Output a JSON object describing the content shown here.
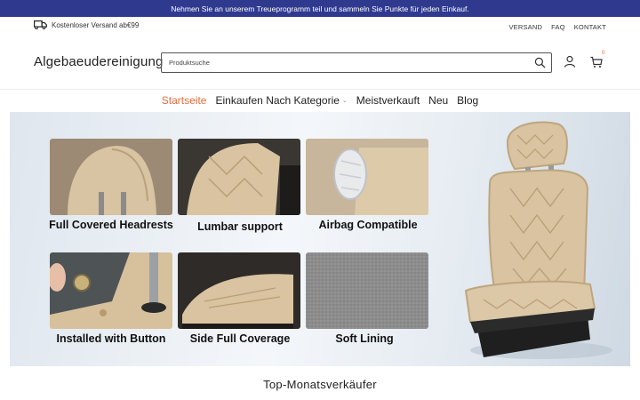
{
  "announcement": "Nehmen Sie an unserem Treueprogramm teil und sammeln Sie Punkte für jeden Einkauf.",
  "topbar": {
    "shipping_text": "Kostenloser Versand ab€99",
    "shipping_icon": "truck-icon",
    "links": [
      "VERSAND",
      "FAQ",
      "KONTAKT"
    ]
  },
  "header": {
    "logo": "Algebaeudereinigung",
    "search_placeholder": "Produktsuche",
    "cart_count": "0",
    "icons": [
      "search-icon",
      "user-icon",
      "cart-icon"
    ]
  },
  "nav": {
    "items": [
      {
        "label": "Startseite",
        "active": true
      },
      {
        "label": "Einkaufen Nach Kategorie",
        "dropdown": true
      },
      {
        "label": "Meistverkauft"
      },
      {
        "label": "Neu"
      },
      {
        "label": "Blog"
      }
    ]
  },
  "hero": {
    "features": [
      "Full Covered Headrests",
      "Lumbar support",
      "Airbag Compatible",
      "Installed with Button",
      "Side Full Coverage",
      "Soft Lining"
    ]
  },
  "section_title": "Top-Monatsverkäufer",
  "colors": {
    "announce_bg": "#2f3a8f",
    "accent": "#e46d3a",
    "beige": "#d9c3a0"
  }
}
